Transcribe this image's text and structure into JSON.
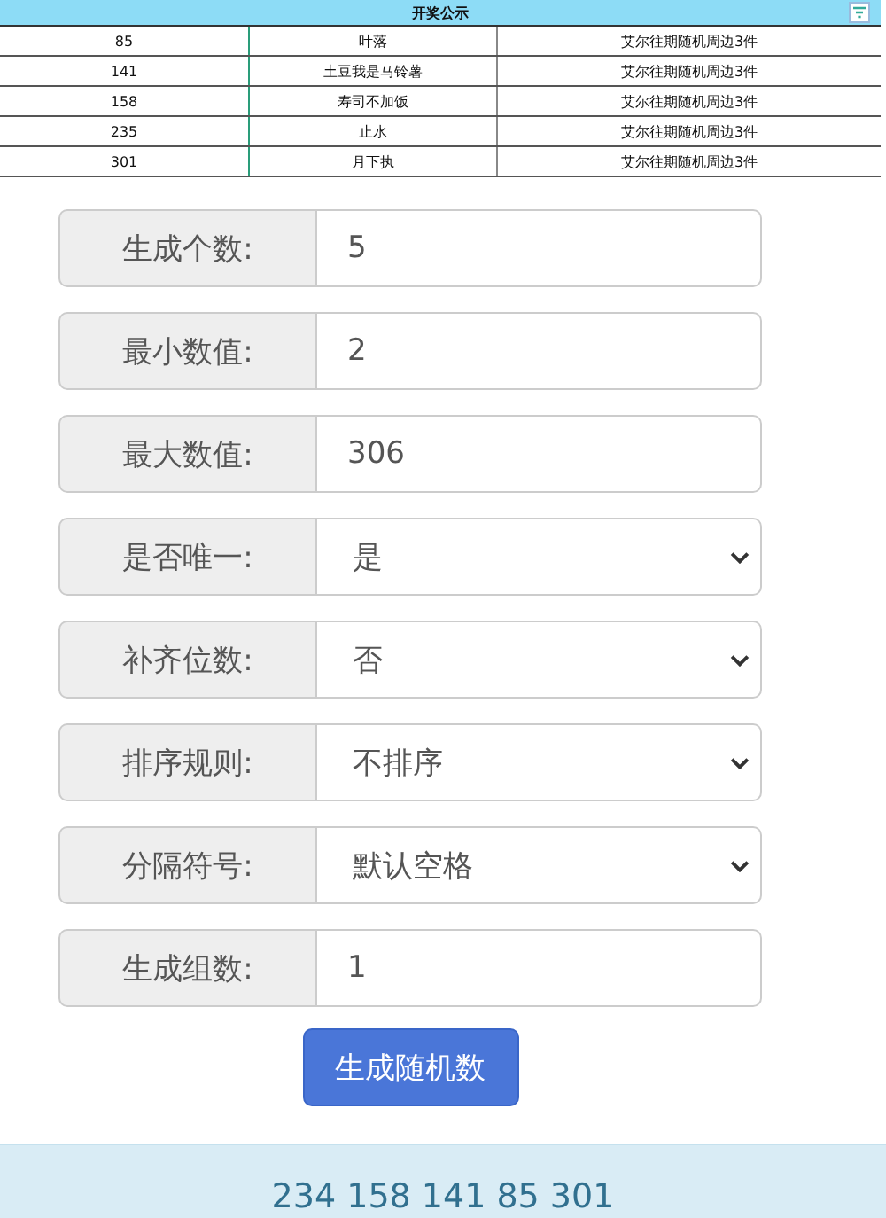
{
  "table": {
    "title": "开奖公示",
    "rows": [
      [
        "85",
        "叶落",
        "艾尔往期随机周边3件"
      ],
      [
        "141",
        "土豆我是马铃薯",
        "艾尔往期随机周边3件"
      ],
      [
        "158",
        "寿司不加饭",
        "艾尔往期随机周边3件"
      ],
      [
        "235",
        "止水",
        "艾尔往期随机周边3件"
      ],
      [
        "301",
        "月下执",
        "艾尔往期随机周边3件"
      ]
    ]
  },
  "form": [
    {
      "label": "生成个数:",
      "kind": "input",
      "value": "5"
    },
    {
      "label": "最小数值:",
      "kind": "input",
      "value": "2"
    },
    {
      "label": "最大数值:",
      "kind": "input",
      "value": "306"
    },
    {
      "label": "是否唯一:",
      "kind": "select",
      "value": "是"
    },
    {
      "label": "补齐位数:",
      "kind": "select",
      "value": "否"
    },
    {
      "label": "排序规则:",
      "kind": "select",
      "value": "不排序"
    },
    {
      "label": "分隔符号:",
      "kind": "select",
      "value": "默认空格"
    },
    {
      "label": "生成组数:",
      "kind": "input",
      "value": "1"
    }
  ],
  "button": "生成随机数",
  "result": "234 158 141 85 301"
}
